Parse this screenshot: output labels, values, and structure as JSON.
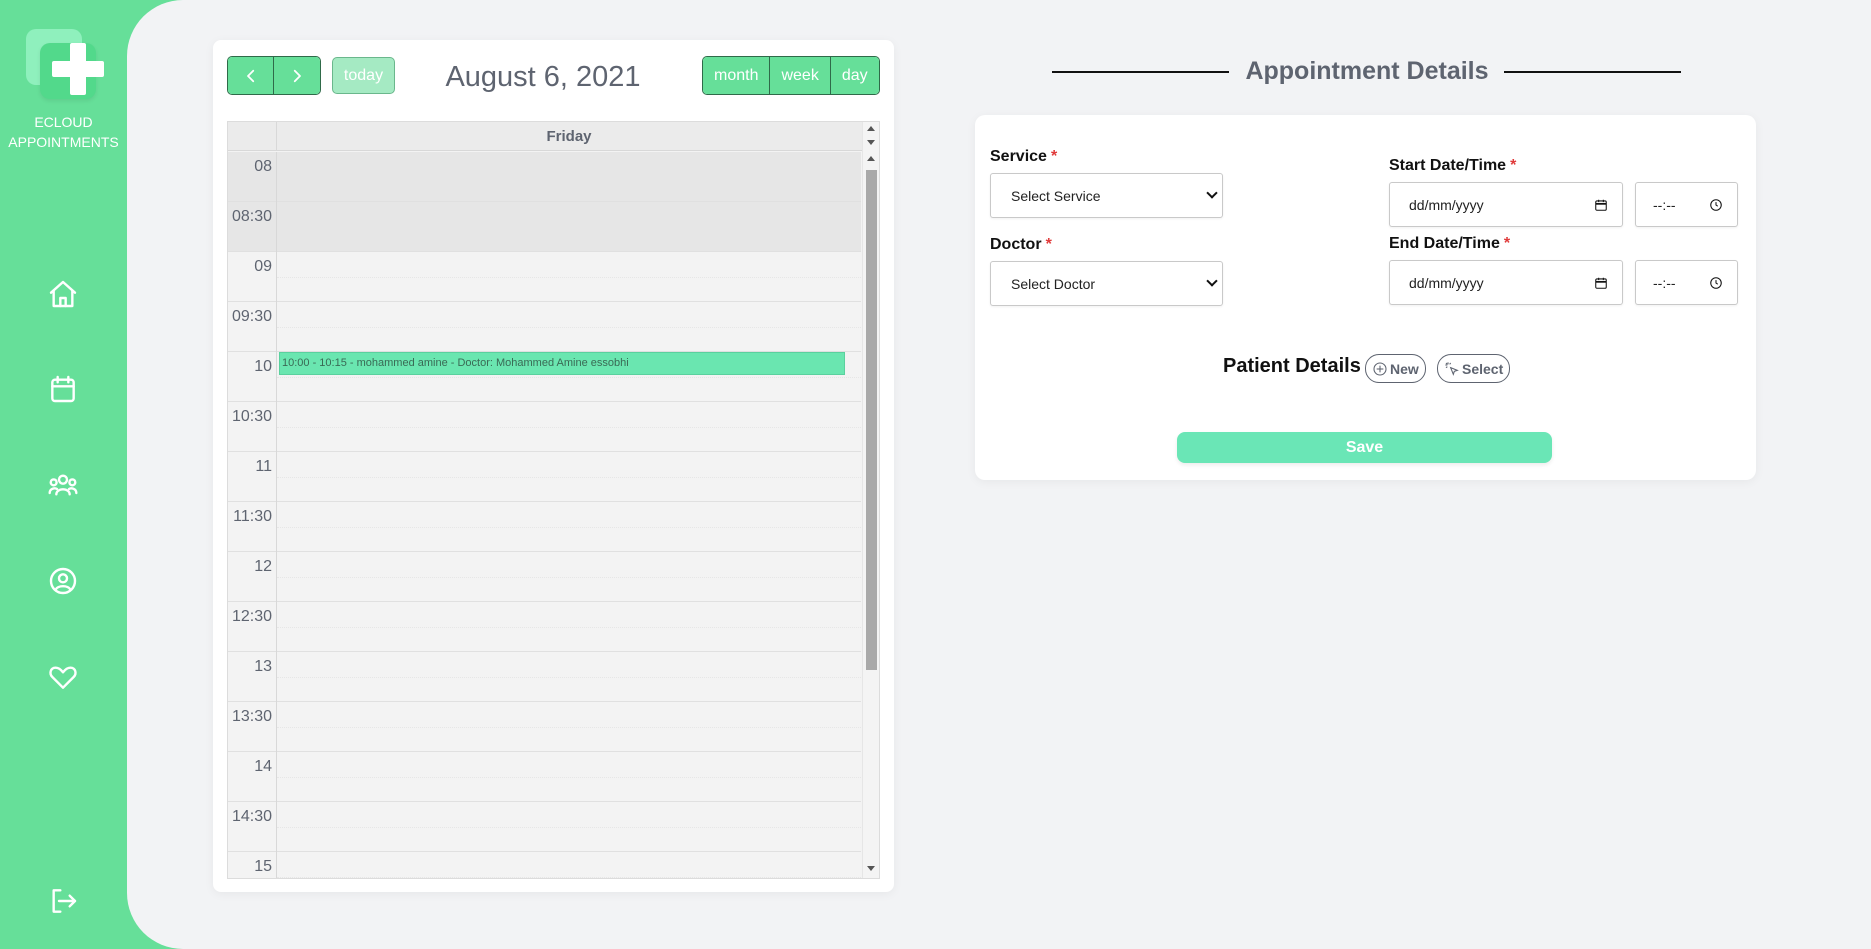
{
  "app": {
    "brand_line1": "ECLOUD",
    "brand_line2": "APPOINTMENTS"
  },
  "sidebar": {
    "items": [
      {
        "icon": "home-icon"
      },
      {
        "icon": "calendar-icon"
      },
      {
        "icon": "users-icon"
      },
      {
        "icon": "user-circle-icon"
      },
      {
        "icon": "heart-icon"
      }
    ],
    "logout_icon": "logout-icon"
  },
  "calendar": {
    "today_label": "today",
    "title": "August 6, 2021",
    "views": {
      "month": "month",
      "week": "week",
      "day": "day"
    },
    "day_header": "Friday",
    "time_slots": [
      "08",
      "08:30",
      "09",
      "09:30",
      "10",
      "10:30",
      "11",
      "11:30",
      "12",
      "12:30",
      "13",
      "13:30",
      "14",
      "14:30",
      "15"
    ],
    "event": {
      "text": "10:00 - 10:15 - mohammed amine - Doctor: Mohammed Amine essobhi",
      "color": "#6ae6b0"
    }
  },
  "appointment": {
    "title": "Appointment Details",
    "service_label": "Service",
    "service_value": "Select Service",
    "doctor_label": "Doctor",
    "doctor_value": "Select Doctor",
    "start_label": "Start Date/Time",
    "end_label": "End Date/Time",
    "date_placeholder": "dd/mm/yyyy",
    "time_placeholder": "--:--",
    "required_mark": "*",
    "patient_title": "Patient Details",
    "new_label": "New",
    "select_label": "Select",
    "save_label": "Save"
  },
  "colors": {
    "brand": "#66df99",
    "panel": "#f2f3f5",
    "required": "#e03a3a"
  }
}
